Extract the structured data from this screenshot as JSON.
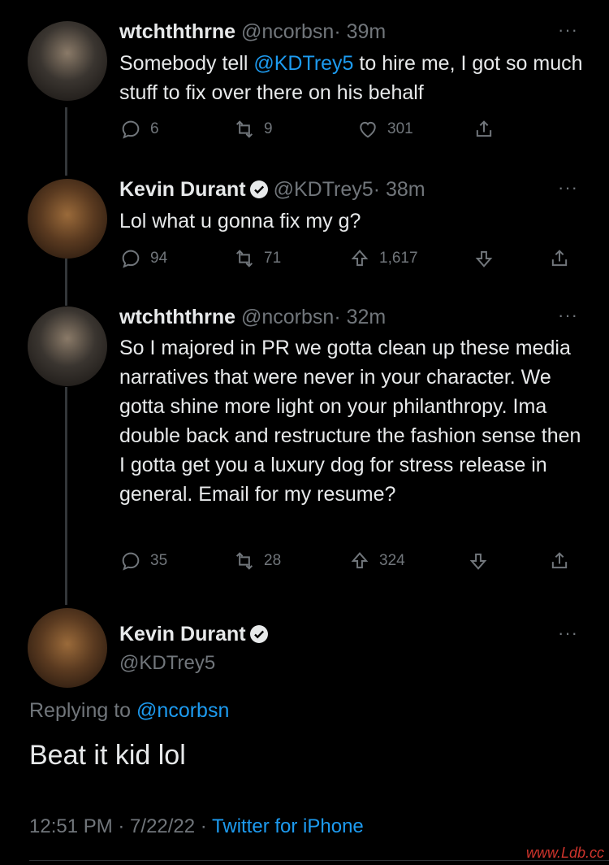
{
  "tweets": [
    {
      "name": "wtchththrne",
      "handle": "@ncorbsn",
      "time": "· 39m",
      "text_before": "Somebody tell ",
      "mention": "@KDTrey5",
      "text_after": " to hire me, I got so much stuff to fix over there on his behalf",
      "replies": "6",
      "retweets": "9",
      "likes": "301"
    },
    {
      "name": "Kevin Durant",
      "handle": "@KDTrey5",
      "time": "· 38m",
      "text": "Lol what u gonna fix my g?",
      "replies": "94",
      "retweets": "71",
      "upvotes": "1,617"
    },
    {
      "name": "wtchththrne",
      "handle": "@ncorbsn",
      "time": "· 32m",
      "text": "So I majored in PR we gotta clean up these media narratives that were never in your character. We gotta shine more light on your philanthropy. Ima double back and restructure the fashion sense then I gotta get you a luxury dog for stress release in general. Email for my resume?",
      "replies": "35",
      "retweets": "28",
      "upvotes": "324"
    }
  ],
  "focal": {
    "name": "Kevin Durant",
    "handle": "@KDTrey5",
    "replying_label": "Replying to ",
    "replying_to": "@ncorbsn",
    "text": "Beat it kid lol",
    "time": "12:51 PM · 7/22/22 · ",
    "source": "Twitter for iPhone"
  },
  "more_icon": "···",
  "watermark": "www.Ldb.cc",
  "colors": {
    "accent": "#1d9bf0",
    "muted": "#71767b",
    "background": "#000000",
    "text": "#e7e9ea"
  }
}
